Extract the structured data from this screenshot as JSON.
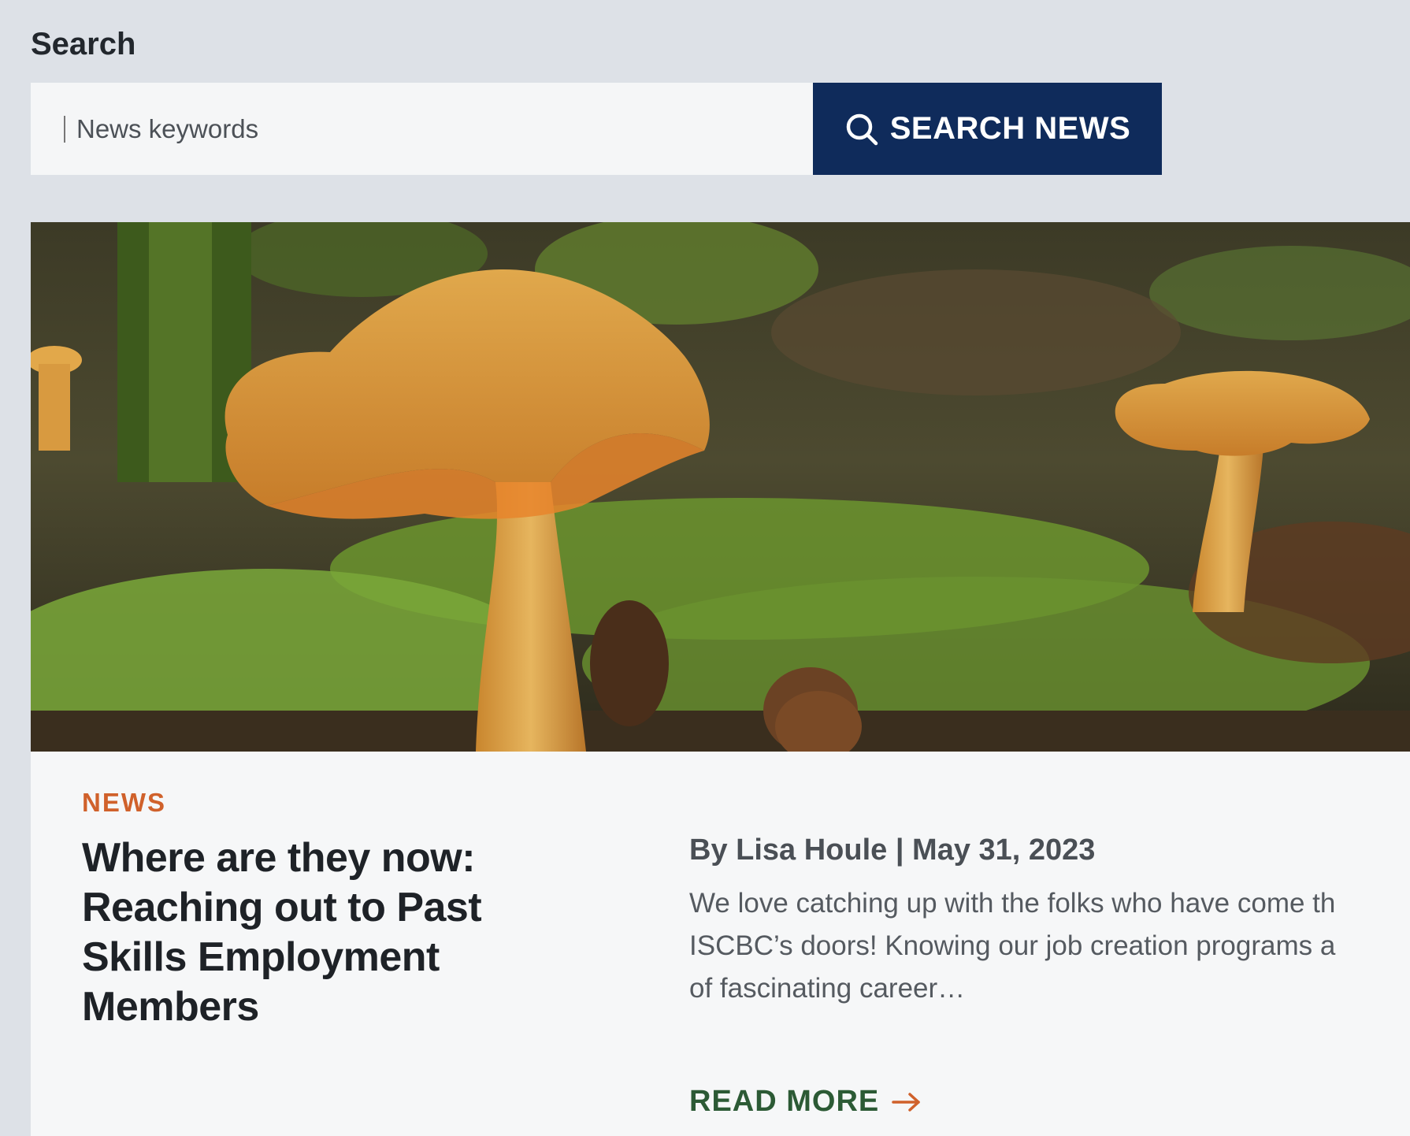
{
  "search": {
    "label": "Search",
    "placeholder": "News keywords",
    "button_label": "SEARCH NEWS",
    "button_icon": "search-icon"
  },
  "article": {
    "category": "NEWS",
    "title": "Where are they now: Reaching out to Past Skills Employment Members",
    "byline": "By Lisa Houle | May 31, 2023",
    "excerpt_lines": [
      "We love catching up with the folks who have come th",
      "ISCBC’s doors! Knowing our job creation programs a",
      "of fascinating career…"
    ],
    "read_more_label": "READ MORE",
    "read_more_icon": "arrow-right-icon"
  },
  "colors": {
    "button_bg": "#0f2b5b",
    "category": "#d0612b",
    "read_more": "#2c5a35",
    "page_bg": "#dde1e7"
  }
}
